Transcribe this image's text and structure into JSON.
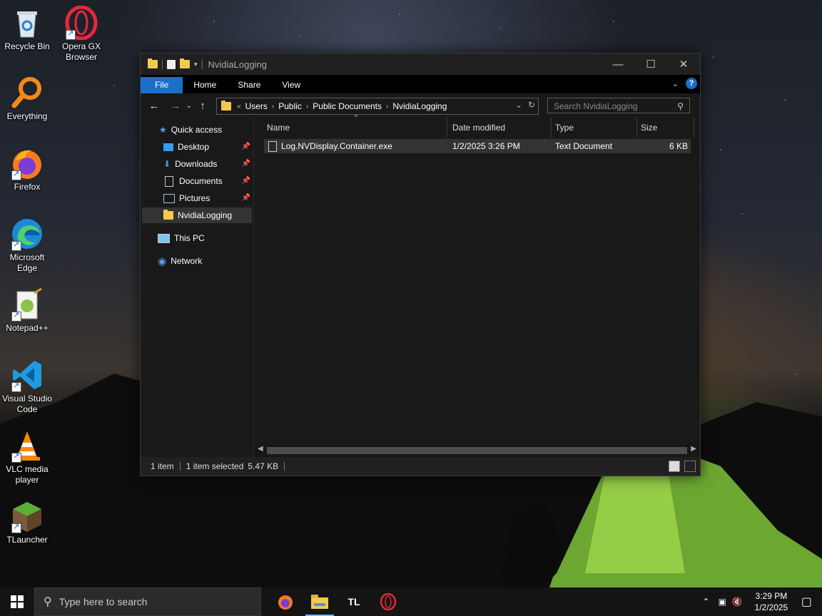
{
  "desktop": {
    "icons": [
      {
        "label": "Recycle Bin",
        "icon": "recycle-bin-icon"
      },
      {
        "label": "Opera GX Browser",
        "icon": "opera-gx-icon"
      },
      {
        "label": "Everything",
        "icon": "everything-search-icon"
      },
      {
        "label": "Firefox",
        "icon": "firefox-icon"
      },
      {
        "label": "Microsoft Edge",
        "icon": "edge-icon"
      },
      {
        "label": "Notepad++",
        "icon": "notepad-plus-plus-icon"
      },
      {
        "label": "Visual Studio Code",
        "icon": "vscode-icon"
      },
      {
        "label": "VLC media player",
        "icon": "vlc-icon"
      },
      {
        "label": "TLauncher",
        "icon": "tlauncher-icon"
      }
    ]
  },
  "window": {
    "title": "NvidiaLogging",
    "ribbon": {
      "file": "File",
      "home": "Home",
      "share": "Share",
      "view": "View",
      "help": "?"
    },
    "address": {
      "crumbs": [
        "Users",
        "Public",
        "Public Documents",
        "NvidiaLogging"
      ]
    },
    "search": {
      "placeholder": "Search NvidiaLogging"
    },
    "nav": {
      "quick_access": "Quick access",
      "desktop": "Desktop",
      "downloads": "Downloads",
      "documents": "Documents",
      "pictures": "Pictures",
      "nvidialogging": "NvidiaLogging",
      "this_pc": "This PC",
      "network": "Network"
    },
    "columns": {
      "name": "Name",
      "date": "Date modified",
      "type": "Type",
      "size": "Size"
    },
    "files": [
      {
        "name": "Log.NVDisplay.Container.exe",
        "date": "1/2/2025 3:26 PM",
        "type": "Text Document",
        "size": "6 KB"
      }
    ],
    "status": {
      "count": "1 item",
      "selected": "1 item selected",
      "size": "5.47 KB"
    }
  },
  "taskbar": {
    "search_placeholder": "Type here to search",
    "tl_label": "TL",
    "time": "3:29 PM",
    "date": "1/2/2025"
  },
  "colors": {
    "accent": "#1a6fc9",
    "folder": "#f3c94d"
  }
}
